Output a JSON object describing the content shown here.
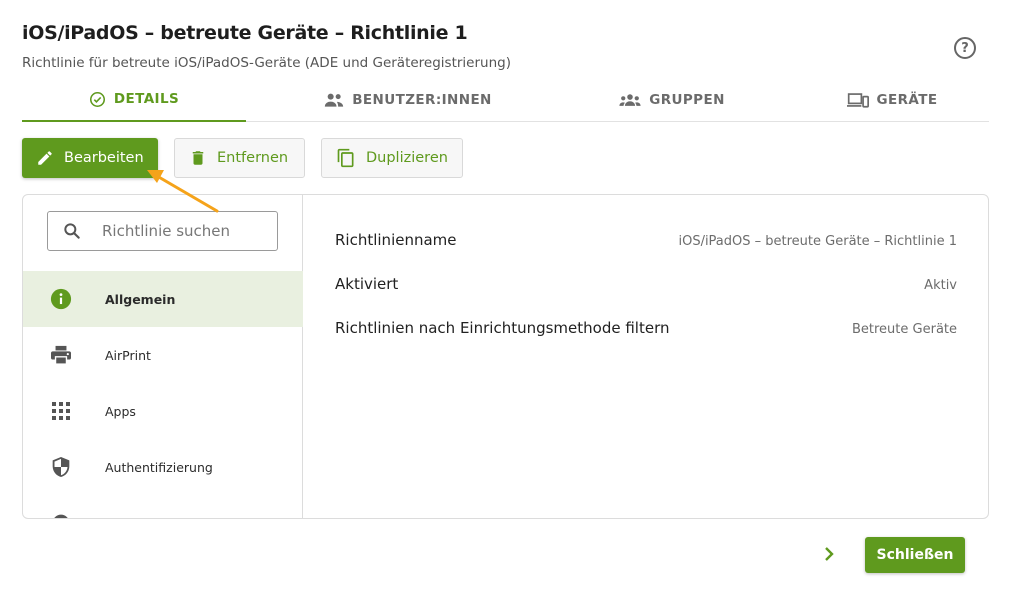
{
  "header": {
    "title": "iOS/iPadOS – betreute Geräte – Richtlinie 1",
    "subtitle": "Richtlinie für betreute iOS/iPadOS-Geräte (ADE und Geräteregistrierung)",
    "help_icon": "help-circle-icon"
  },
  "tabs": [
    {
      "label": "DETAILS",
      "icon": "check-circle-icon",
      "active": true
    },
    {
      "label": "BENUTZER:INNEN",
      "icon": "people-icon",
      "active": false
    },
    {
      "label": "GRUPPEN",
      "icon": "groups-icon",
      "active": false
    },
    {
      "label": "GERÄTE",
      "icon": "devices-icon",
      "active": false
    }
  ],
  "toolbar": {
    "edit_label": "Bearbeiten",
    "remove_label": "Entfernen",
    "duplicate_label": "Duplizieren"
  },
  "sidebar": {
    "search_placeholder": "Richtlinie suchen",
    "items": [
      {
        "label": "Allgemein",
        "icon": "info-icon",
        "active": true
      },
      {
        "label": "AirPrint",
        "icon": "printer-icon",
        "active": false
      },
      {
        "label": "Apps",
        "icon": "apps-grid-icon",
        "active": false
      },
      {
        "label": "Authentifizierung",
        "icon": "shield-icon",
        "active": false
      }
    ]
  },
  "details": [
    {
      "key": "Richtlinienname",
      "value": "iOS/iPadOS – betreute Geräte – Richtlinie 1"
    },
    {
      "key": "Aktiviert",
      "value": "Aktiv"
    },
    {
      "key": "Richtlinien nach Einrichtungsmethode filtern",
      "value": "Betreute Geräte"
    }
  ],
  "footer": {
    "close_label": "Schließen"
  },
  "colors": {
    "accent": "#5f9a1e",
    "active_bg": "#e9f0e0",
    "annotation_arrow": "#f5a31a"
  }
}
